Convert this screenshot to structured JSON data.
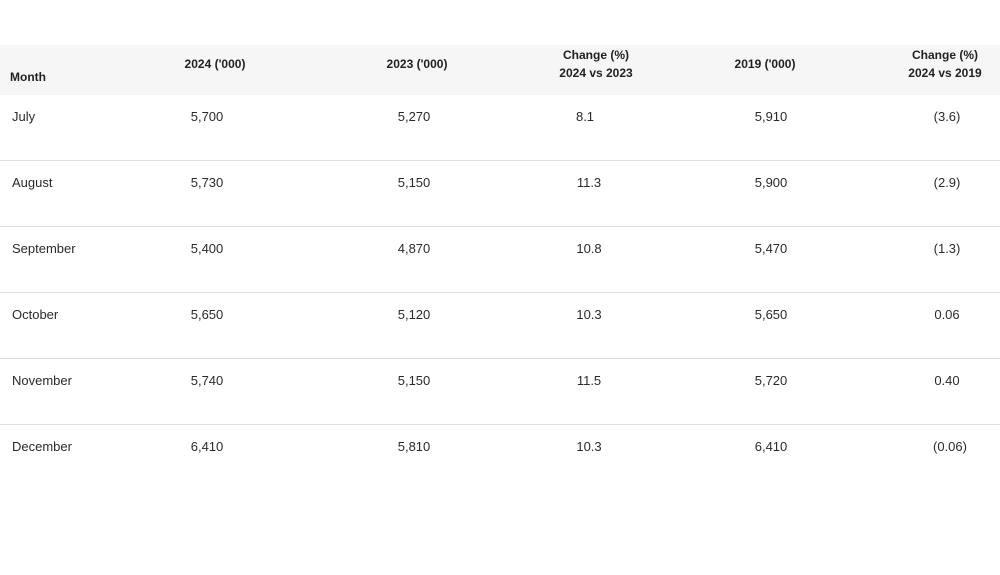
{
  "table": {
    "headers": {
      "month": "Month",
      "y2024": "2024 ('000)",
      "y2023": "2023 ('000)",
      "change_2023_line1": "Change (%)",
      "change_2023_line2": "2024 vs 2023",
      "y2019": "2019 ('000)",
      "change_2019_line1": "Change (%)",
      "change_2019_line2": "2024 vs 2019"
    },
    "rows": [
      {
        "month": "July",
        "y2024": "5,700",
        "y2023": "5,270",
        "change_2023": "8.1",
        "y2019": "5,910",
        "change_2019": "(3.6)"
      },
      {
        "month": "August",
        "y2024": "5,730",
        "y2023": "5,150",
        "change_2023": "11.3",
        "y2019": "5,900",
        "change_2019": "(2.9)"
      },
      {
        "month": "September",
        "y2024": "5,400",
        "y2023": "4,870",
        "change_2023": "10.8",
        "y2019": "5,470",
        "change_2019": "(1.3)"
      },
      {
        "month": "October",
        "y2024": "5,650",
        "y2023": "5,120",
        "change_2023": "10.3",
        "y2019": "5,650",
        "change_2019": "0.06"
      },
      {
        "month": "November",
        "y2024": "5,740",
        "y2023": "5,150",
        "change_2023": "11.5",
        "y2019": "5,720",
        "change_2019": "0.40"
      },
      {
        "month": "December",
        "y2024": "6,410",
        "y2023": "5,810",
        "change_2023": "10.3",
        "y2019": "6,410",
        "change_2019": "(0.06)"
      }
    ]
  }
}
